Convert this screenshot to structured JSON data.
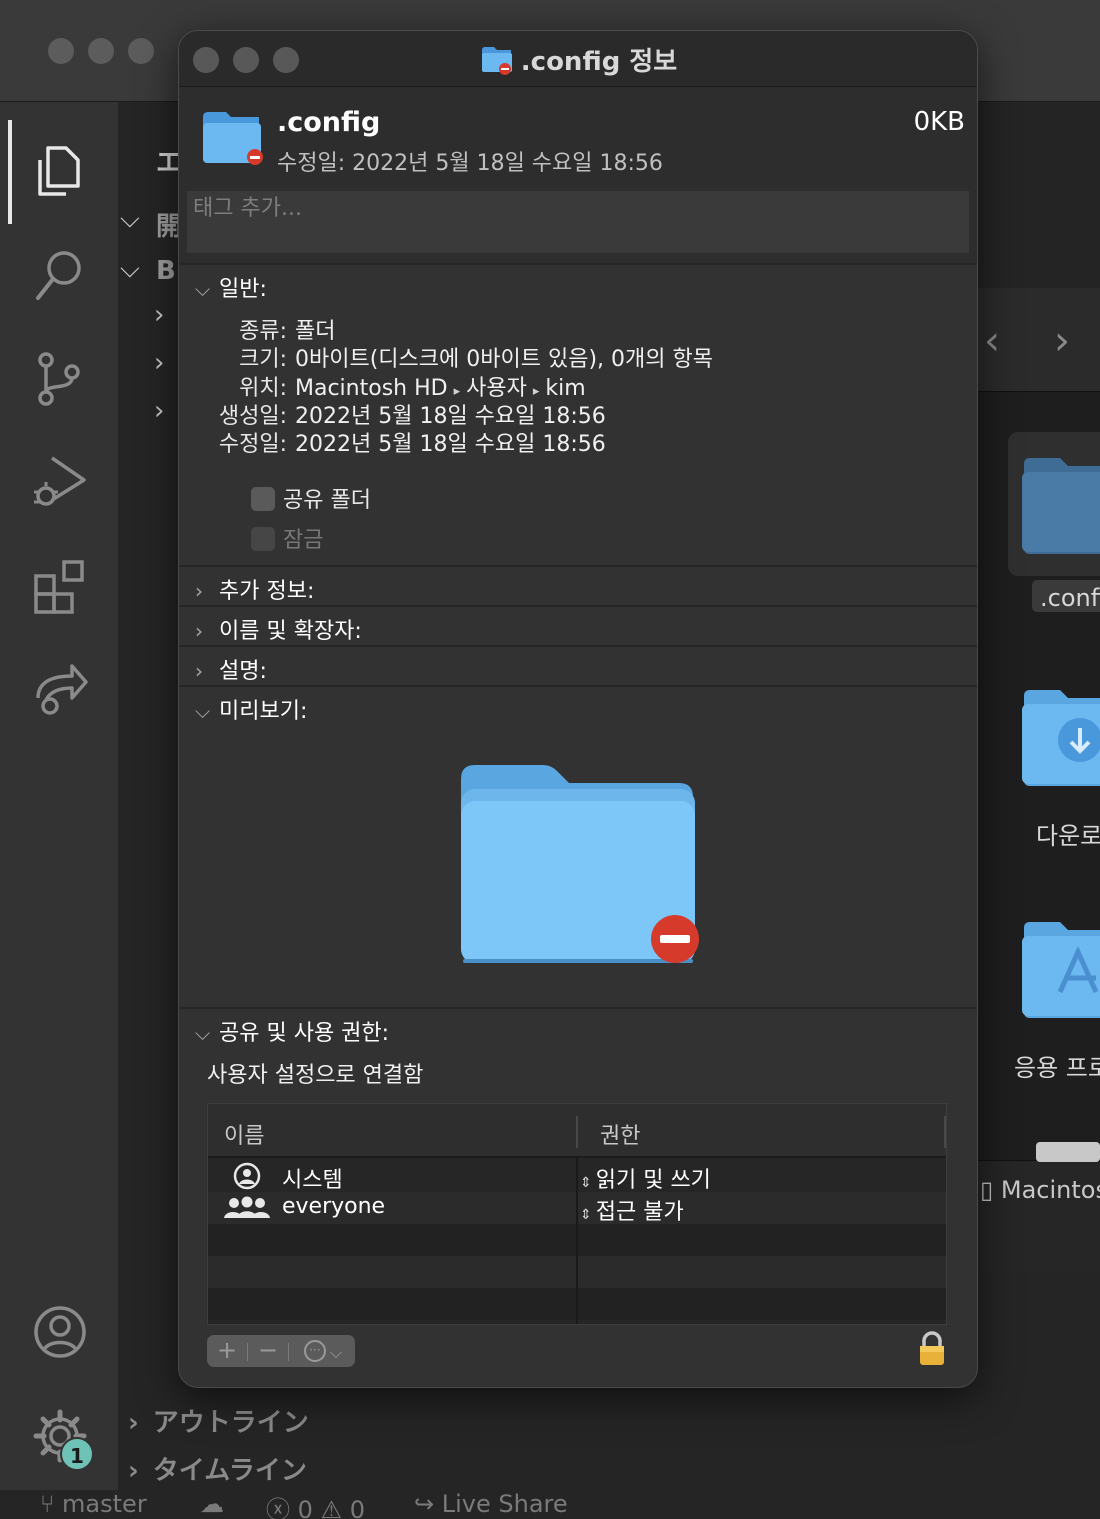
{
  "vscode": {
    "sidebar_partial_labels": [
      "エ",
      "開",
      "BI"
    ],
    "bottom_panels": [
      "アウトライン",
      "タイムライン"
    ],
    "badge_count": "1",
    "statusbar": {
      "branch": "master",
      "errors": "0",
      "warnings": "0",
      "live_share": "Live Share"
    }
  },
  "finder": {
    "items": [
      ".confi",
      "다운로",
      "응용 프로"
    ],
    "path_label": "Macintosh"
  },
  "info_window": {
    "title": ".config 정보",
    "header": {
      "name": ".config",
      "modified": "수정일: 2022년 5월 18일 수요일 18:56",
      "size": "0KB",
      "tags_placeholder": "태그 추가..."
    },
    "general": {
      "heading": "일반:",
      "rows": [
        {
          "label": "종류:",
          "value": "폴더"
        },
        {
          "label": "크기:",
          "value": "0바이트(디스크에 0바이트 있음), 0개의 항목"
        },
        {
          "label": "위치:",
          "path": [
            "Macintosh HD",
            "사용자",
            "kim"
          ]
        },
        {
          "label": "생성일:",
          "value": "2022년 5월 18일 수요일 18:56"
        },
        {
          "label": "수정일:",
          "value": "2022년 5월 18일 수요일 18:56"
        }
      ],
      "shared_folder": "공유 폴더",
      "locked": "잠금"
    },
    "more_info": "추가 정보:",
    "name_ext": "이름 및 확장자:",
    "comments": "설명:",
    "preview": "미리보기:",
    "sharing": {
      "heading": "공유 및 사용 권한:",
      "description": "사용자 설정으로 연결함",
      "col_name": "이름",
      "col_privilege": "권한",
      "rows": [
        {
          "name": "시스템",
          "privilege": "읽기 및 쓰기",
          "icon": "single-user-icon"
        },
        {
          "name": "everyone",
          "privilege": "접근 불가",
          "icon": "group-users-icon"
        }
      ],
      "add_label": "+",
      "remove_label": "−",
      "action_label": "···"
    }
  }
}
